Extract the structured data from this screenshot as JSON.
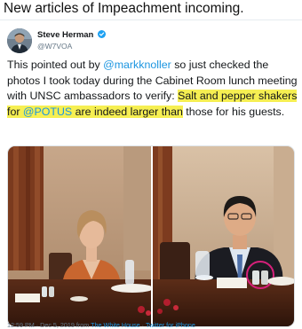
{
  "caption": "New articles of Impeachment incoming.",
  "author": {
    "name": "Steve Herman",
    "handle": "@W7VOA",
    "verified_icon": "verified-badge-icon",
    "accent": "#1da1f2"
  },
  "tweet": {
    "text_pre": "This pointed out by ",
    "mention_1": "@markknoller",
    "text_mid": " so just checked the photos I took today during the Cabinet Room lunch meeting with UNSC ambassadors to verify: ",
    "highlight_pre": "Salt and pepper shakers for ",
    "mention_2": "@POTUS",
    "highlight_post": " are  indeed larger than",
    "text_post": " those for his guests.",
    "highlight_color": "#f6ef52",
    "link_color": "#1b95e0"
  },
  "meta": {
    "time": "12:59 PM · Dec 5, 2019 from ",
    "place": "The White House",
    "separator": " · ",
    "source": "Twitter for iPhone"
  },
  "media": {
    "photo_left": "cabinet-room-photo-ambassador-woman",
    "photo_right": "cabinet-room-photo-ambassador-man"
  }
}
